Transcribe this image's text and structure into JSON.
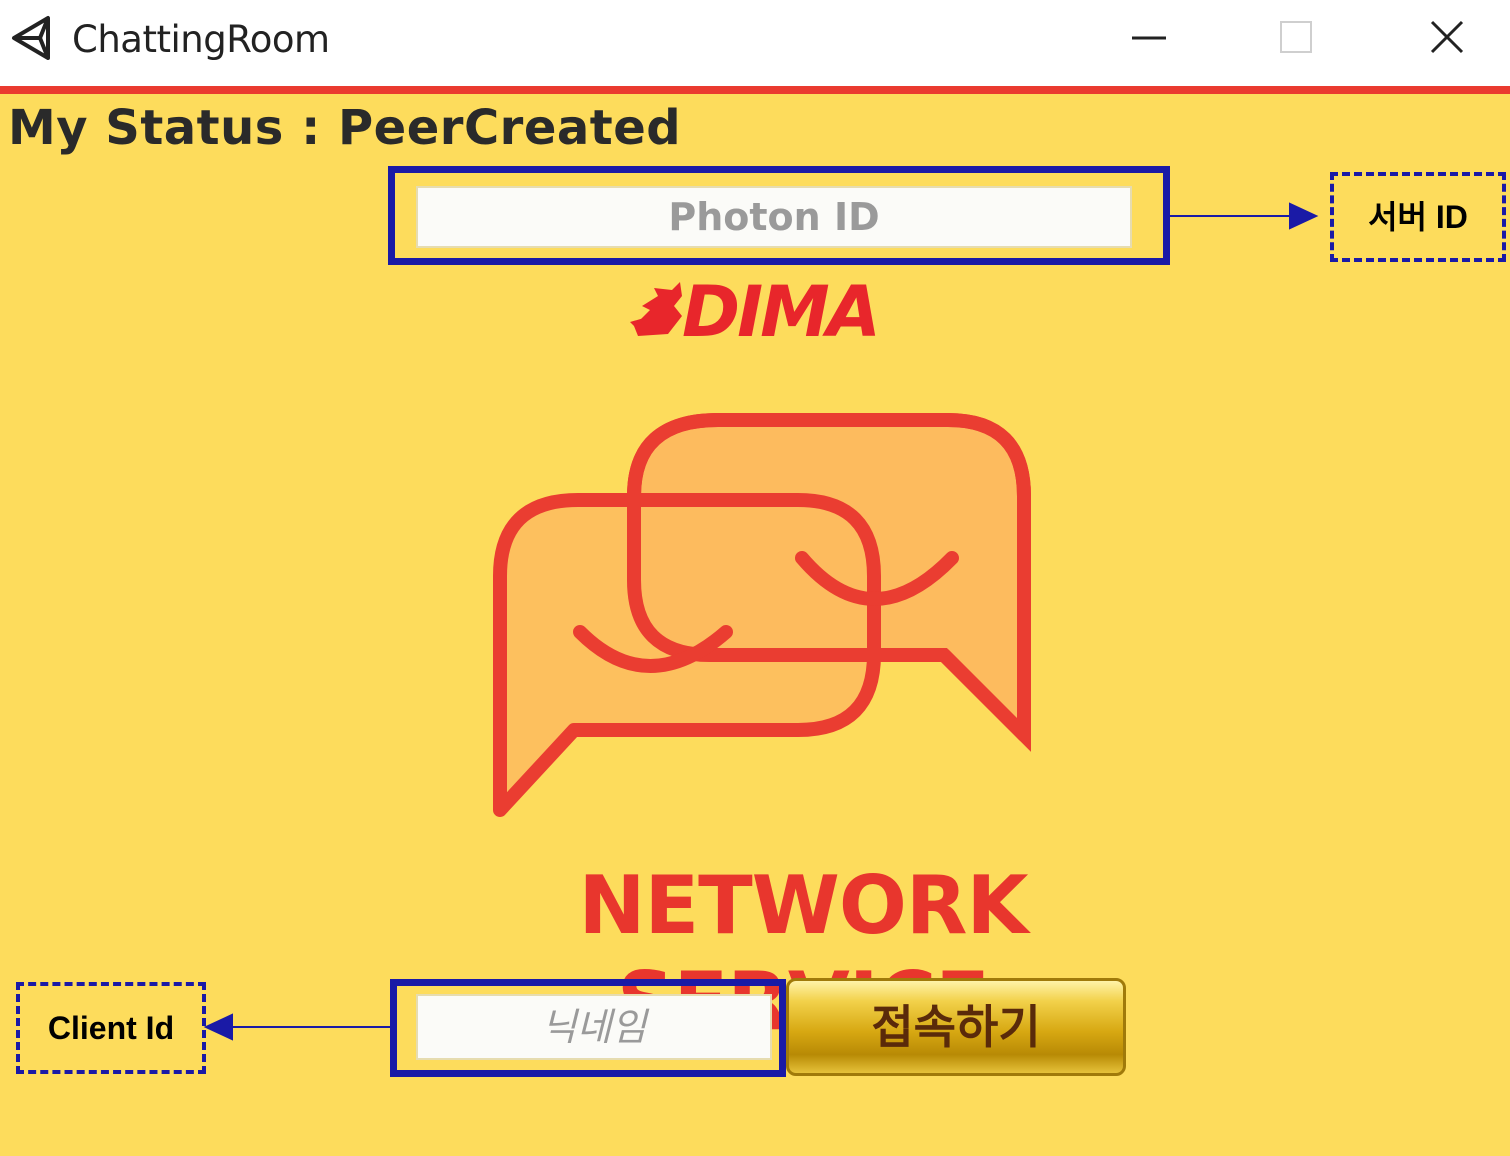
{
  "window": {
    "title": "ChattingRoom",
    "icon": "unity-icon",
    "controls": [
      "minimize-icon",
      "maximize-icon",
      "close-icon"
    ]
  },
  "status": {
    "label": "My Status : PeerCreated"
  },
  "server_input": {
    "placeholder": "Photon ID",
    "value": ""
  },
  "logo": {
    "brand": "DIMA"
  },
  "hero": {
    "title": "NETWORK SERVICE",
    "icon": "chat-bubbles-icon"
  },
  "nickname_input": {
    "placeholder": "닉네임",
    "value": ""
  },
  "connect_button": {
    "label": "접속하기"
  },
  "annotations": {
    "server": "서버 ID",
    "client": "Client Id"
  },
  "colors": {
    "background": "#fddc5c",
    "accent_red": "#ea3a2f",
    "highlight_blue": "#1a1aa6",
    "button_gold": "#d7a812"
  }
}
